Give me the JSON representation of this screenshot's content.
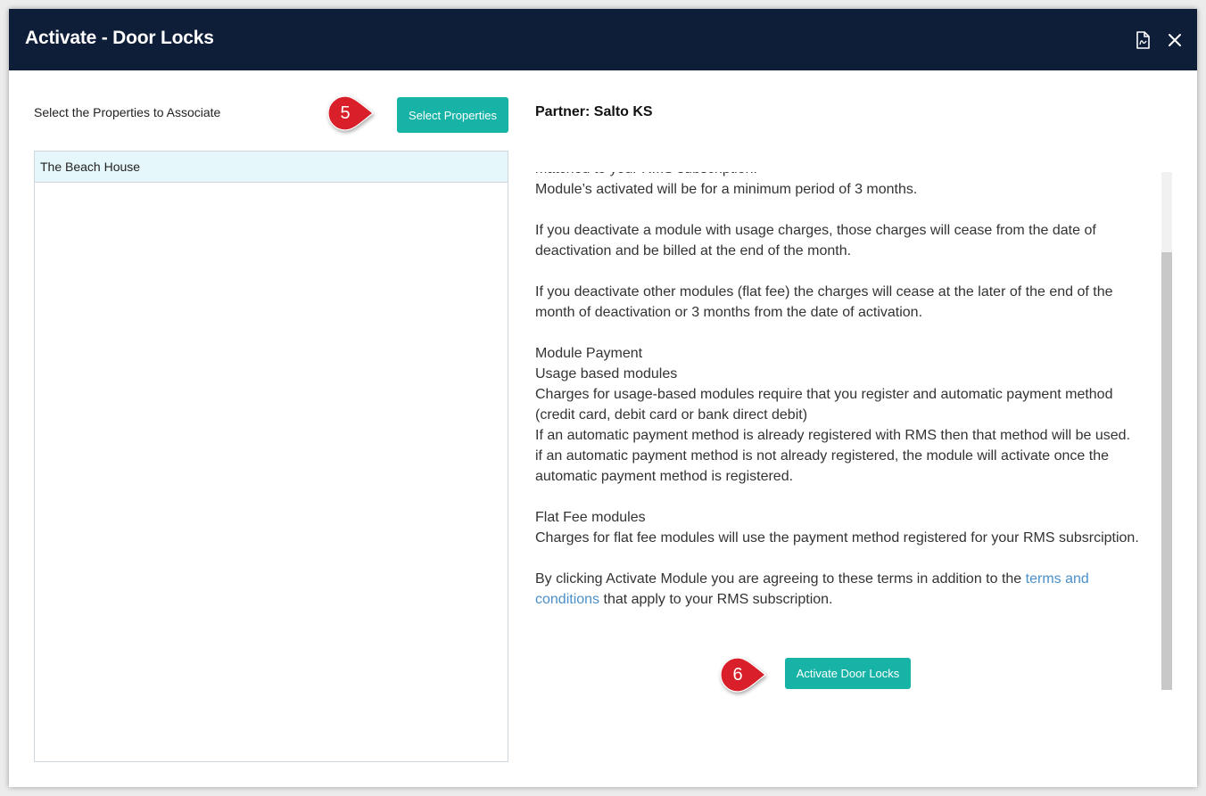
{
  "dialog": {
    "title": "Activate - Door Locks",
    "pdf_icon": "pdf-document-icon",
    "close_icon": "close-icon"
  },
  "left": {
    "select_label": "Select the Properties to Associate",
    "select_button": "Select Properties",
    "properties": [
      "The Beach House"
    ]
  },
  "right": {
    "partner": "Partner: Salto KS",
    "terms": {
      "cut_line": "matched to your RMS subscription.",
      "min_period": "Module’s activated will be for a minimum period of 3 months.",
      "usage_deactivate": "If you deactivate a module with usage charges, those charges will cease from the date of deactivation and be billed at the end of the month.",
      "flat_deactivate": "If you deactivate other modules (flat fee) the charges will cease at the later of the end of the month of deactivation or 3 months from the date of activation.",
      "payment_heading": "Module Payment",
      "usage_heading": "Usage based modules",
      "usage_line1": "Charges for usage-based modules require that you register and automatic payment method (credit card, debit card or bank direct debit)",
      "usage_line2": "If an automatic payment method is already registered with RMS then that method will be used.",
      "usage_line3": "if an automatic payment method is not already registered, the module will activate once the automatic payment method is registered.",
      "flat_heading": "Flat Fee modules",
      "flat_line": "Charges for flat fee modules will use the payment method registered for your RMS subsrciption.",
      "agree_prefix": "By clicking Activate Module you are agreeing to these terms in addition to the ",
      "agree_link": "terms and conditions",
      "agree_suffix": " that apply to your RMS subscription."
    },
    "activate_button": "Activate Door Locks"
  },
  "annotations": {
    "step5": "5",
    "step6": "6",
    "color": "#d81f2a"
  },
  "colors": {
    "header": "#0e1d38",
    "button": "#16b3a6",
    "link": "#4a8fc9",
    "selected_row": "#e5f7fb"
  }
}
